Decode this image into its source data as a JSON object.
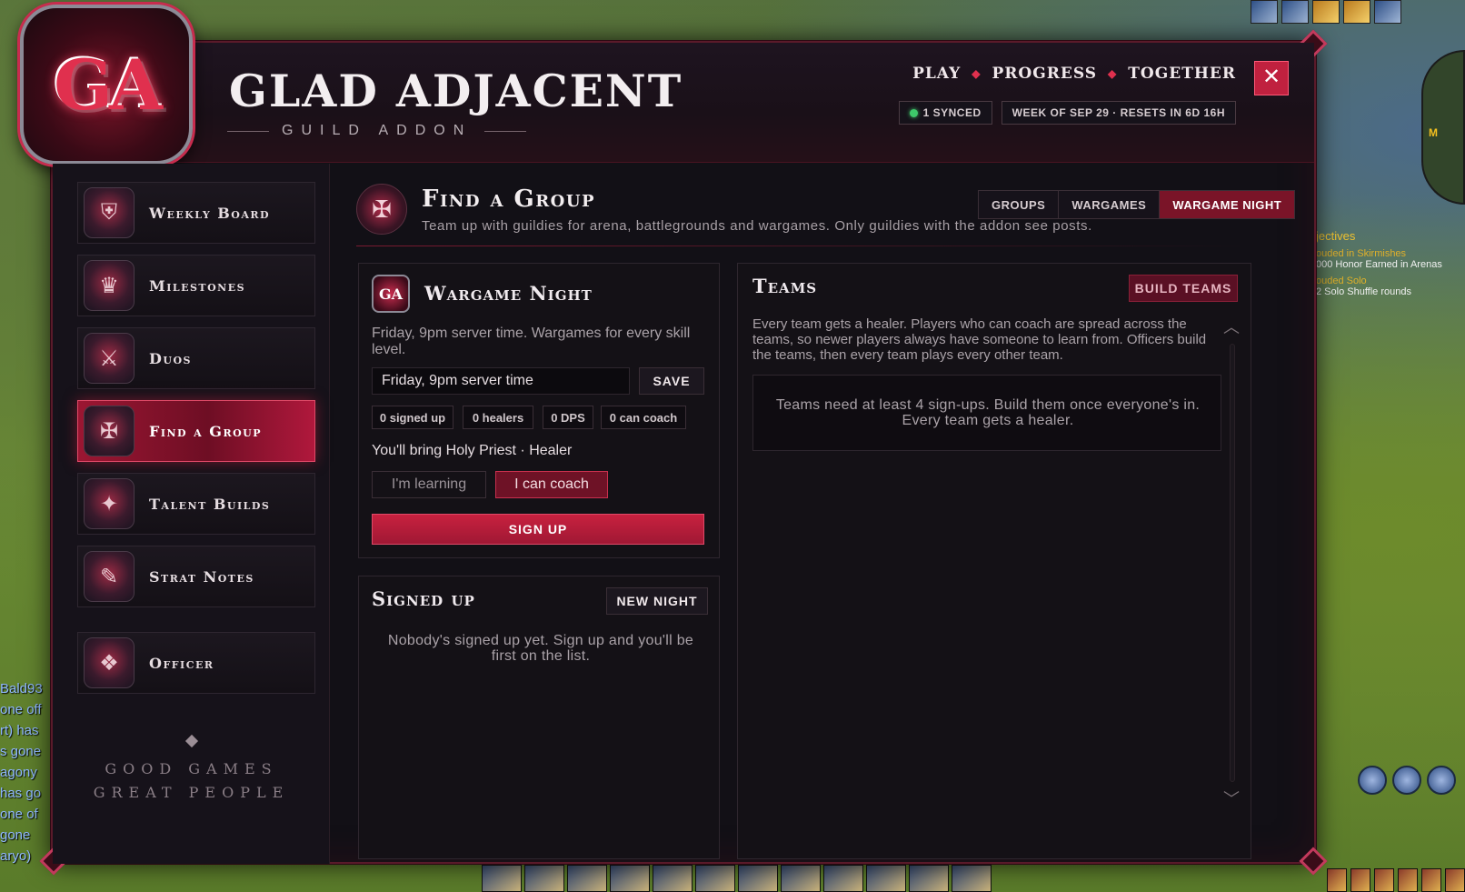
{
  "app": {
    "logo_text": "GA",
    "title": "GLAD ADJACENT",
    "subtitle": "GUILD ADDON",
    "close_label": "✕"
  },
  "topnav": {
    "items": [
      "PLAY",
      "PROGRESS",
      "TOGETHER"
    ]
  },
  "status": {
    "synced": "1 SYNCED",
    "week": "WEEK OF SEP 29 · RESETS IN 6D 16H"
  },
  "sidebar": {
    "items": [
      {
        "label": "Weekly Board",
        "icon": "shield-icon"
      },
      {
        "label": "Milestones",
        "icon": "trophy-icon"
      },
      {
        "label": "Duos",
        "icon": "crossed-swords-icon"
      },
      {
        "label": "Find a Group",
        "icon": "group-emblem-icon",
        "active": true
      },
      {
        "label": "Talent Builds",
        "icon": "spellbook-icon"
      },
      {
        "label": "Strat Notes",
        "icon": "scroll-icon"
      },
      {
        "label": "Officer",
        "icon": "officer-crest-icon"
      }
    ],
    "motto_line1": "GOOD GAMES",
    "motto_line2": "GREAT PEOPLE"
  },
  "header": {
    "title": "Find a Group",
    "subtitle": "Team up with guildies for arena, battlegrounds and wargames. Only guildies with the addon see posts.",
    "tabs": [
      "GROUPS",
      "WARGAMES",
      "WARGAME NIGHT"
    ],
    "active_tab": "WARGAME NIGHT"
  },
  "wargame": {
    "title": "Wargame Night",
    "icon_text": "GA",
    "description": "Friday, 9pm server time. Wargames for every skill level.",
    "time_value": "Friday, 9pm server time",
    "save_label": "SAVE",
    "stats": [
      "0 signed up",
      "0 healers",
      "0 DPS",
      "0 can coach"
    ],
    "bring_text": "You'll bring Holy Priest · Healer",
    "toggle_learning": "I'm learning",
    "toggle_coach": "I can coach",
    "coach_selected": true,
    "signup_label": "SIGN UP"
  },
  "signed_up": {
    "title": "Signed up",
    "new_night_label": "NEW NIGHT",
    "empty": "Nobody's signed up yet. Sign up and you'll be first on the list."
  },
  "teams": {
    "title": "Teams",
    "build_label": "BUILD TEAMS",
    "description": "Every team gets a healer. Players who can coach are spread across the teams, so newer players always have someone to learn from. Officers build the teams, then every team plays every other team.",
    "empty": "Teams need at least 4 sign-ups. Build them once everyone's in. Every team gets a healer."
  },
  "background": {
    "objectives_head": "jectives",
    "objectives_lines": [
      "ouded in Skirmishes",
      "000 Honor Earned in Arenas",
      "ouded Solo",
      "2 Solo Shuffle rounds"
    ],
    "chat_lines": [
      "Bald93",
      "one off",
      "rt) has",
      "s gone",
      " agony",
      "has go",
      "one of",
      "gone",
      "aryo)"
    ],
    "minimap_label": "M"
  },
  "colors": {
    "accent": "#c0213f",
    "panel": "#141116",
    "text": "#e6dde1",
    "status_green": "#3ec86a"
  }
}
